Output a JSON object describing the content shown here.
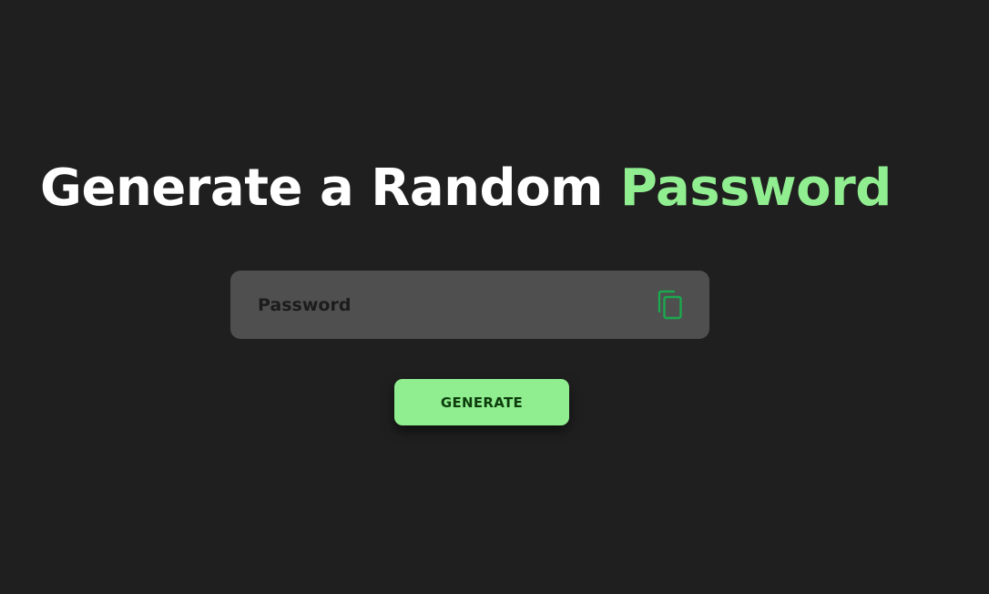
{
  "heading": {
    "part1": "Generate a Random ",
    "part2": "Password"
  },
  "password_field": {
    "placeholder": "Password",
    "value": ""
  },
  "copy_button": {
    "icon": "copy-icon"
  },
  "generate_button": {
    "label": "GENERATE"
  },
  "colors": {
    "background": "#1f1f1f",
    "accent": "#90ee90",
    "field_background": "#4f4f4f",
    "icon": "#1aa84f"
  }
}
